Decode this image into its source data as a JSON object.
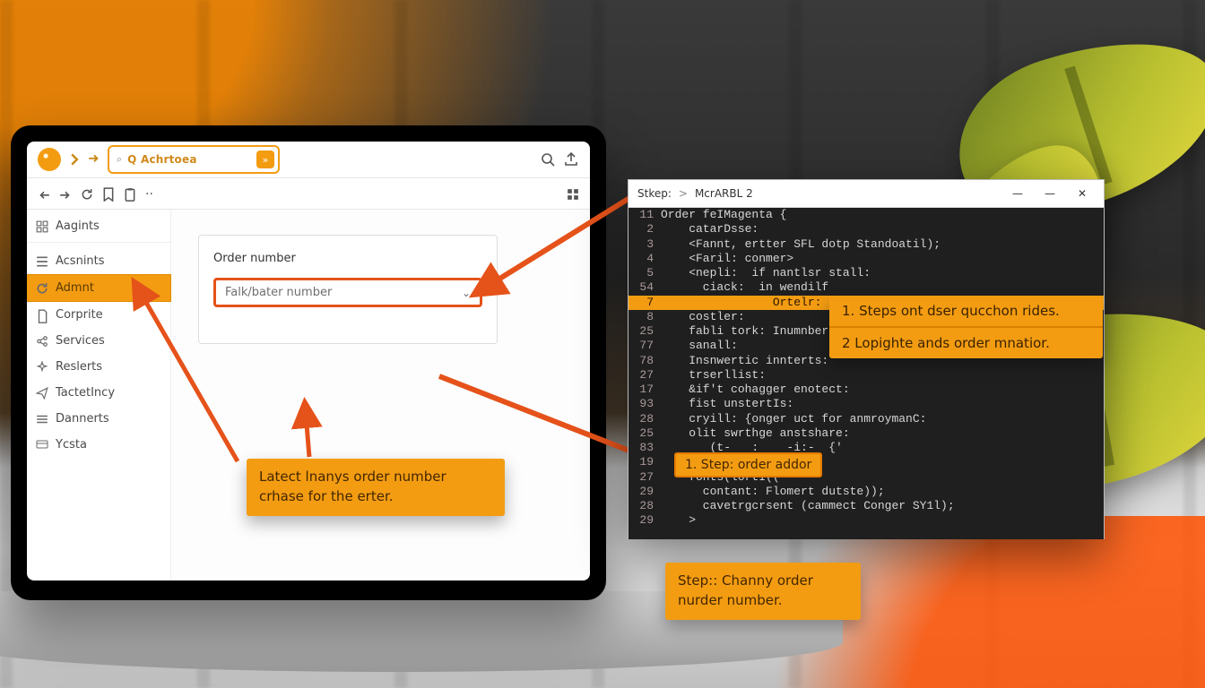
{
  "topbar": {
    "search_placeholder": "Q Achrtoea",
    "search_go": "»"
  },
  "sidebar": {
    "items": [
      {
        "label": "Aagints",
        "kind": "grid"
      },
      {
        "label": "Acsnints",
        "kind": "list"
      },
      {
        "label": "Admnt",
        "kind": "refresh",
        "active": true
      },
      {
        "label": "Corprite",
        "kind": "doc"
      },
      {
        "label": "Services",
        "kind": "share"
      },
      {
        "label": "Reslerts",
        "kind": "spark"
      },
      {
        "label": "TactetIncy",
        "kind": "send"
      },
      {
        "label": "Dannerts",
        "kind": "list"
      },
      {
        "label": "Ycsta",
        "kind": "card"
      }
    ]
  },
  "card": {
    "title": "Order number",
    "select_value": "Falk/bater number"
  },
  "callout_main": {
    "line1": "Latect lnanys order number",
    "line2": "crhase for the erter."
  },
  "editor": {
    "breadcrumb_a": "Stkep:",
    "breadcrumb_sep": ">",
    "breadcrumb_b": "McrARBL 2",
    "lines": [
      {
        "num": "11",
        "txt": "Order feIMagenta {"
      },
      {
        "num": "2",
        "txt": "    catarDsse:"
      },
      {
        "num": "3",
        "txt": "    <Fannt, ertter SFL dotp Standoatil);"
      },
      {
        "num": "4",
        "txt": "    <Faril: conmer>"
      },
      {
        "num": "5",
        "txt": "    <nepli:  if nantlsr stall:"
      },
      {
        "num": "54",
        "txt": "      ciack:  in wendilf"
      },
      {
        "num": "7",
        "txt": "                Ortelr: HAB",
        "hi": true
      },
      {
        "num": "8",
        "txt": "    costler:"
      },
      {
        "num": "25",
        "txt": "    fabli tork: Inumnber-"
      },
      {
        "num": "77",
        "txt": "    sanall:"
      },
      {
        "num": "78",
        "txt": "    Insnwertic innterts:"
      },
      {
        "num": "27",
        "txt": "    trserllist:"
      },
      {
        "num": "17",
        "txt": "    &if't cohagger enotect:"
      },
      {
        "num": "93",
        "txt": "    fist unstertIs:"
      },
      {
        "num": "28",
        "txt": "    cryill: {onger uct for anmroymanC:"
      },
      {
        "num": "25",
        "txt": "    olit swrthge anstshare:"
      },
      {
        "num": "83",
        "txt": "       (t-   :    -i:-  {'"
      },
      {
        "num": "19",
        "txt": ""
      },
      {
        "num": "27",
        "txt": "    fonts(lortI(("
      },
      {
        "num": "29",
        "txt": "      contant: Flomert dutste));"
      },
      {
        "num": "28",
        "txt": "      cavetrgcrsent (cammect Conger SY1l);"
      },
      {
        "num": "29",
        "txt": "    >"
      }
    ]
  },
  "ed_steps": {
    "row1": "1. Steps ont dser qucchon rides.",
    "row2": "2 Lopighte ands order mnatior."
  },
  "ed_chip": "1. Step: order addor",
  "ed_bottom": {
    "line1": "Step:: Channy order",
    "line2": "nurder number."
  }
}
